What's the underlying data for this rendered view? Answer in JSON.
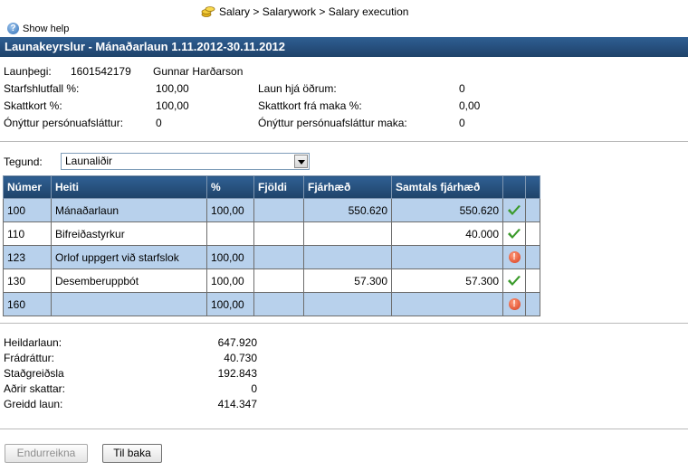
{
  "breadcrumb": {
    "icon": "coins-icon",
    "text": "Salary > Salarywork > Salary execution"
  },
  "help": {
    "label": "Show help"
  },
  "title": "Launakeyrslur - Mánaðarlaun 1.11.2012-30.11.2012",
  "employee": {
    "label": "Launþegi:",
    "id": "1601542179",
    "name": "Gunnar Harðarson"
  },
  "info": {
    "starfshlutfall_label": "Starfshlutfall %:",
    "starfshlutfall_value": "100,00",
    "skattkort_label": "Skattkort %:",
    "skattkort_value": "100,00",
    "onyttur_label": "Ónýttur persónuafsláttur:",
    "onyttur_value": "0",
    "laun_hja_label": "Laun hjá öðrum:",
    "laun_hja_value": "0",
    "skattkort_maka_label": "Skattkort frá maka %:",
    "skattkort_maka_value": "0,00",
    "onyttur_maka_label": "Ónýttur persónuafsláttur maka:",
    "onyttur_maka_value": "0"
  },
  "tegund": {
    "label": "Tegund:",
    "selected": "Launaliðir"
  },
  "table": {
    "headers": [
      "Númer",
      "Heiti",
      "%",
      "Fjöldi",
      "Fjárhæð",
      "Samtals fjárhæð",
      "",
      ""
    ],
    "rows": [
      {
        "numer": "100",
        "heiti": "Mánaðarlaun",
        "pct": "100,00",
        "fjoldi": "",
        "fjarhaed": "550.620",
        "samtals": "550.620",
        "status": "ok"
      },
      {
        "numer": "110",
        "heiti": "Bifreiðastyrkur",
        "pct": "",
        "fjoldi": "",
        "fjarhaed": "",
        "samtals": "40.000",
        "status": "ok"
      },
      {
        "numer": "123",
        "heiti": "Orlof uppgert við starfslok",
        "pct": "100,00",
        "fjoldi": "",
        "fjarhaed": "",
        "samtals": "",
        "status": "error"
      },
      {
        "numer": "130",
        "heiti": "Desemberuppbót",
        "pct": "100,00",
        "fjoldi": "",
        "fjarhaed": "57.300",
        "samtals": "57.300",
        "status": "ok"
      },
      {
        "numer": "160",
        "heiti": "",
        "pct": "100,00",
        "fjoldi": "",
        "fjarhaed": "",
        "samtals": "",
        "status": "error"
      }
    ]
  },
  "totals": [
    {
      "label": "Heildarlaun:",
      "value": "647.920"
    },
    {
      "label": "Frádráttur:",
      "value": "40.730"
    },
    {
      "label": "Staðgreiðsla",
      "value": "192.843"
    },
    {
      "label": "Aðrir skattar:",
      "value": "0"
    },
    {
      "label": "Greidd laun:",
      "value": "414.347"
    }
  ],
  "buttons": {
    "recalc": "Endurreikna",
    "back": "Til baka"
  },
  "colors": {
    "header_blue": "#254d7a",
    "row_alt": "#b8d1ec",
    "ok_green": "#3a9a2a",
    "error_red": "#d73a1a"
  }
}
